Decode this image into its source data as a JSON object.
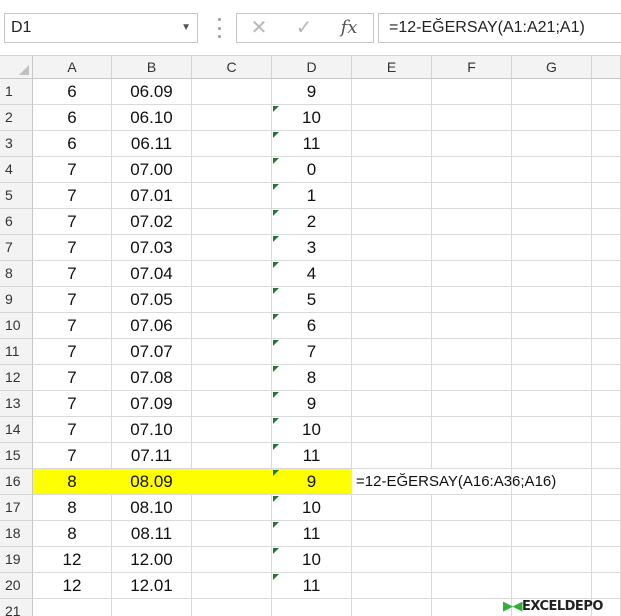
{
  "name_box": "D1",
  "formula": "=12-EĞERSAY(A1:A21;A1)",
  "toolbar": {
    "cancel_icon": "✕",
    "enter_icon": "✓",
    "fx_label": "fx"
  },
  "columns": [
    "A",
    "B",
    "C",
    "D",
    "E",
    "F",
    "G",
    ""
  ],
  "rows": [
    {
      "num": "1",
      "a": "6",
      "b": "06.09",
      "d": "9",
      "tri": false,
      "note": ""
    },
    {
      "num": "2",
      "a": "6",
      "b": "06.10",
      "d": "10",
      "tri": true,
      "note": ""
    },
    {
      "num": "3",
      "a": "6",
      "b": "06.11",
      "d": "11",
      "tri": true,
      "note": ""
    },
    {
      "num": "4",
      "a": "7",
      "b": "07.00",
      "d": "0",
      "tri": true,
      "note": ""
    },
    {
      "num": "5",
      "a": "7",
      "b": "07.01",
      "d": "1",
      "tri": true,
      "note": ""
    },
    {
      "num": "6",
      "a": "7",
      "b": "07.02",
      "d": "2",
      "tri": true,
      "note": ""
    },
    {
      "num": "7",
      "a": "7",
      "b": "07.03",
      "d": "3",
      "tri": true,
      "note": ""
    },
    {
      "num": "8",
      "a": "7",
      "b": "07.04",
      "d": "4",
      "tri": true,
      "note": ""
    },
    {
      "num": "9",
      "a": "7",
      "b": "07.05",
      "d": "5",
      "tri": true,
      "note": ""
    },
    {
      "num": "10",
      "a": "7",
      "b": "07.06",
      "d": "6",
      "tri": true,
      "note": ""
    },
    {
      "num": "11",
      "a": "7",
      "b": "07.07",
      "d": "7",
      "tri": true,
      "note": ""
    },
    {
      "num": "12",
      "a": "7",
      "b": "07.08",
      "d": "8",
      "tri": true,
      "note": ""
    },
    {
      "num": "13",
      "a": "7",
      "b": "07.09",
      "d": "9",
      "tri": true,
      "note": ""
    },
    {
      "num": "14",
      "a": "7",
      "b": "07.10",
      "d": "10",
      "tri": true,
      "note": ""
    },
    {
      "num": "15",
      "a": "7",
      "b": "07.11",
      "d": "11",
      "tri": true,
      "note": ""
    },
    {
      "num": "16",
      "a": "8",
      "b": "08.09",
      "d": "9",
      "tri": true,
      "note": "=12-EĞERSAY(A16:A36;A16)",
      "highlight": true
    },
    {
      "num": "17",
      "a": "8",
      "b": "08.10",
      "d": "10",
      "tri": true,
      "note": ""
    },
    {
      "num": "18",
      "a": "8",
      "b": "08.11",
      "d": "11",
      "tri": true,
      "note": ""
    },
    {
      "num": "19",
      "a": "12",
      "b": "12.00",
      "d": "10",
      "tri": true,
      "note": ""
    },
    {
      "num": "20",
      "a": "12",
      "b": "12.01",
      "d": "11",
      "tri": true,
      "note": ""
    },
    {
      "num": "21",
      "a": "",
      "b": "",
      "d": "",
      "tri": false,
      "note": ""
    }
  ],
  "colors": {
    "highlight": "#ffff00",
    "error_triangle": "#1e7a32"
  },
  "logo": {
    "prefix": "DEPO",
    "text": "EXCELDEPO"
  }
}
